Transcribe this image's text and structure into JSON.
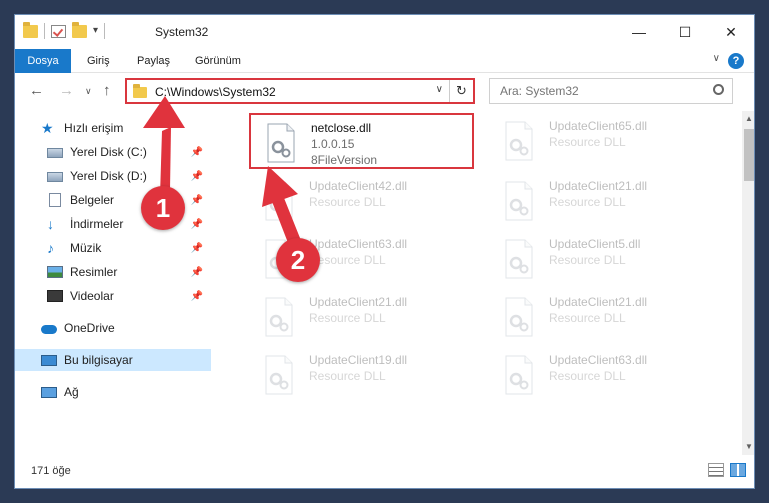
{
  "window": {
    "title": "System32",
    "minimize": "—",
    "maximize": "☐",
    "close": "✕"
  },
  "ribbon": {
    "tabs": [
      "Dosya",
      "Giriş",
      "Paylaş",
      "Görünüm"
    ],
    "help": "?",
    "collapse": "∨"
  },
  "navigation": {
    "back": "←",
    "forward": "→",
    "recent": "∨",
    "up": "↑",
    "address": "C:\\Windows\\System32",
    "address_dropdown": "∨",
    "refresh": "↻",
    "search_placeholder": "Ara: System32"
  },
  "sidebar": {
    "items": [
      {
        "label": "Hızlı erişim",
        "icon": "star-icon"
      },
      {
        "label": "Yerel Disk (C:)",
        "icon": "disk-icon",
        "pinned": true
      },
      {
        "label": "Yerel Disk (D:)",
        "icon": "disk-icon",
        "pinned": true
      },
      {
        "label": "Belgeler",
        "icon": "document-icon",
        "pinned": true
      },
      {
        "label": "İndirmeler",
        "icon": "download-icon",
        "pinned": true
      },
      {
        "label": "Müzik",
        "icon": "music-icon",
        "pinned": true
      },
      {
        "label": "Resimler",
        "icon": "pictures-icon",
        "pinned": true
      },
      {
        "label": "Videolar",
        "icon": "video-icon",
        "pinned": true
      },
      {
        "label": "OneDrive",
        "icon": "cloud-icon"
      },
      {
        "label": "Bu bilgisayar",
        "icon": "computer-icon",
        "selected": true
      },
      {
        "label": "Ağ",
        "icon": "network-icon"
      }
    ],
    "pin_glyph": "📌"
  },
  "files": [
    {
      "name": "netclose.dll",
      "line1": "1.0.0.15",
      "line2": "8FileVersion",
      "highlighted": true
    },
    {
      "name": "UpdateClient65.dll",
      "line1": "Resource DLL"
    },
    {
      "name": "UpdateClient42.dll",
      "line1": "Resource DLL"
    },
    {
      "name": "UpdateClient21.dll",
      "line1": "Resource DLL"
    },
    {
      "name": "UpdateClient63.dll",
      "line1": "Resource DLL"
    },
    {
      "name": "UpdateClient5.dll",
      "line1": "Resource DLL"
    },
    {
      "name": "UpdateClient21.dll",
      "line1": "Resource DLL"
    },
    {
      "name": "UpdateClient21.dll",
      "line1": "Resource DLL"
    },
    {
      "name": "UpdateClient19.dll",
      "line1": "Resource DLL"
    },
    {
      "name": "UpdateClient63.dll",
      "line1": "Resource DLL"
    }
  ],
  "status": {
    "item_count": "171 öğe"
  },
  "callouts": [
    "1",
    "2"
  ],
  "colors": {
    "accent": "#1979ca",
    "highlight": "#d9363e",
    "selected": "#cce8ff",
    "callout": "#e0333d"
  }
}
